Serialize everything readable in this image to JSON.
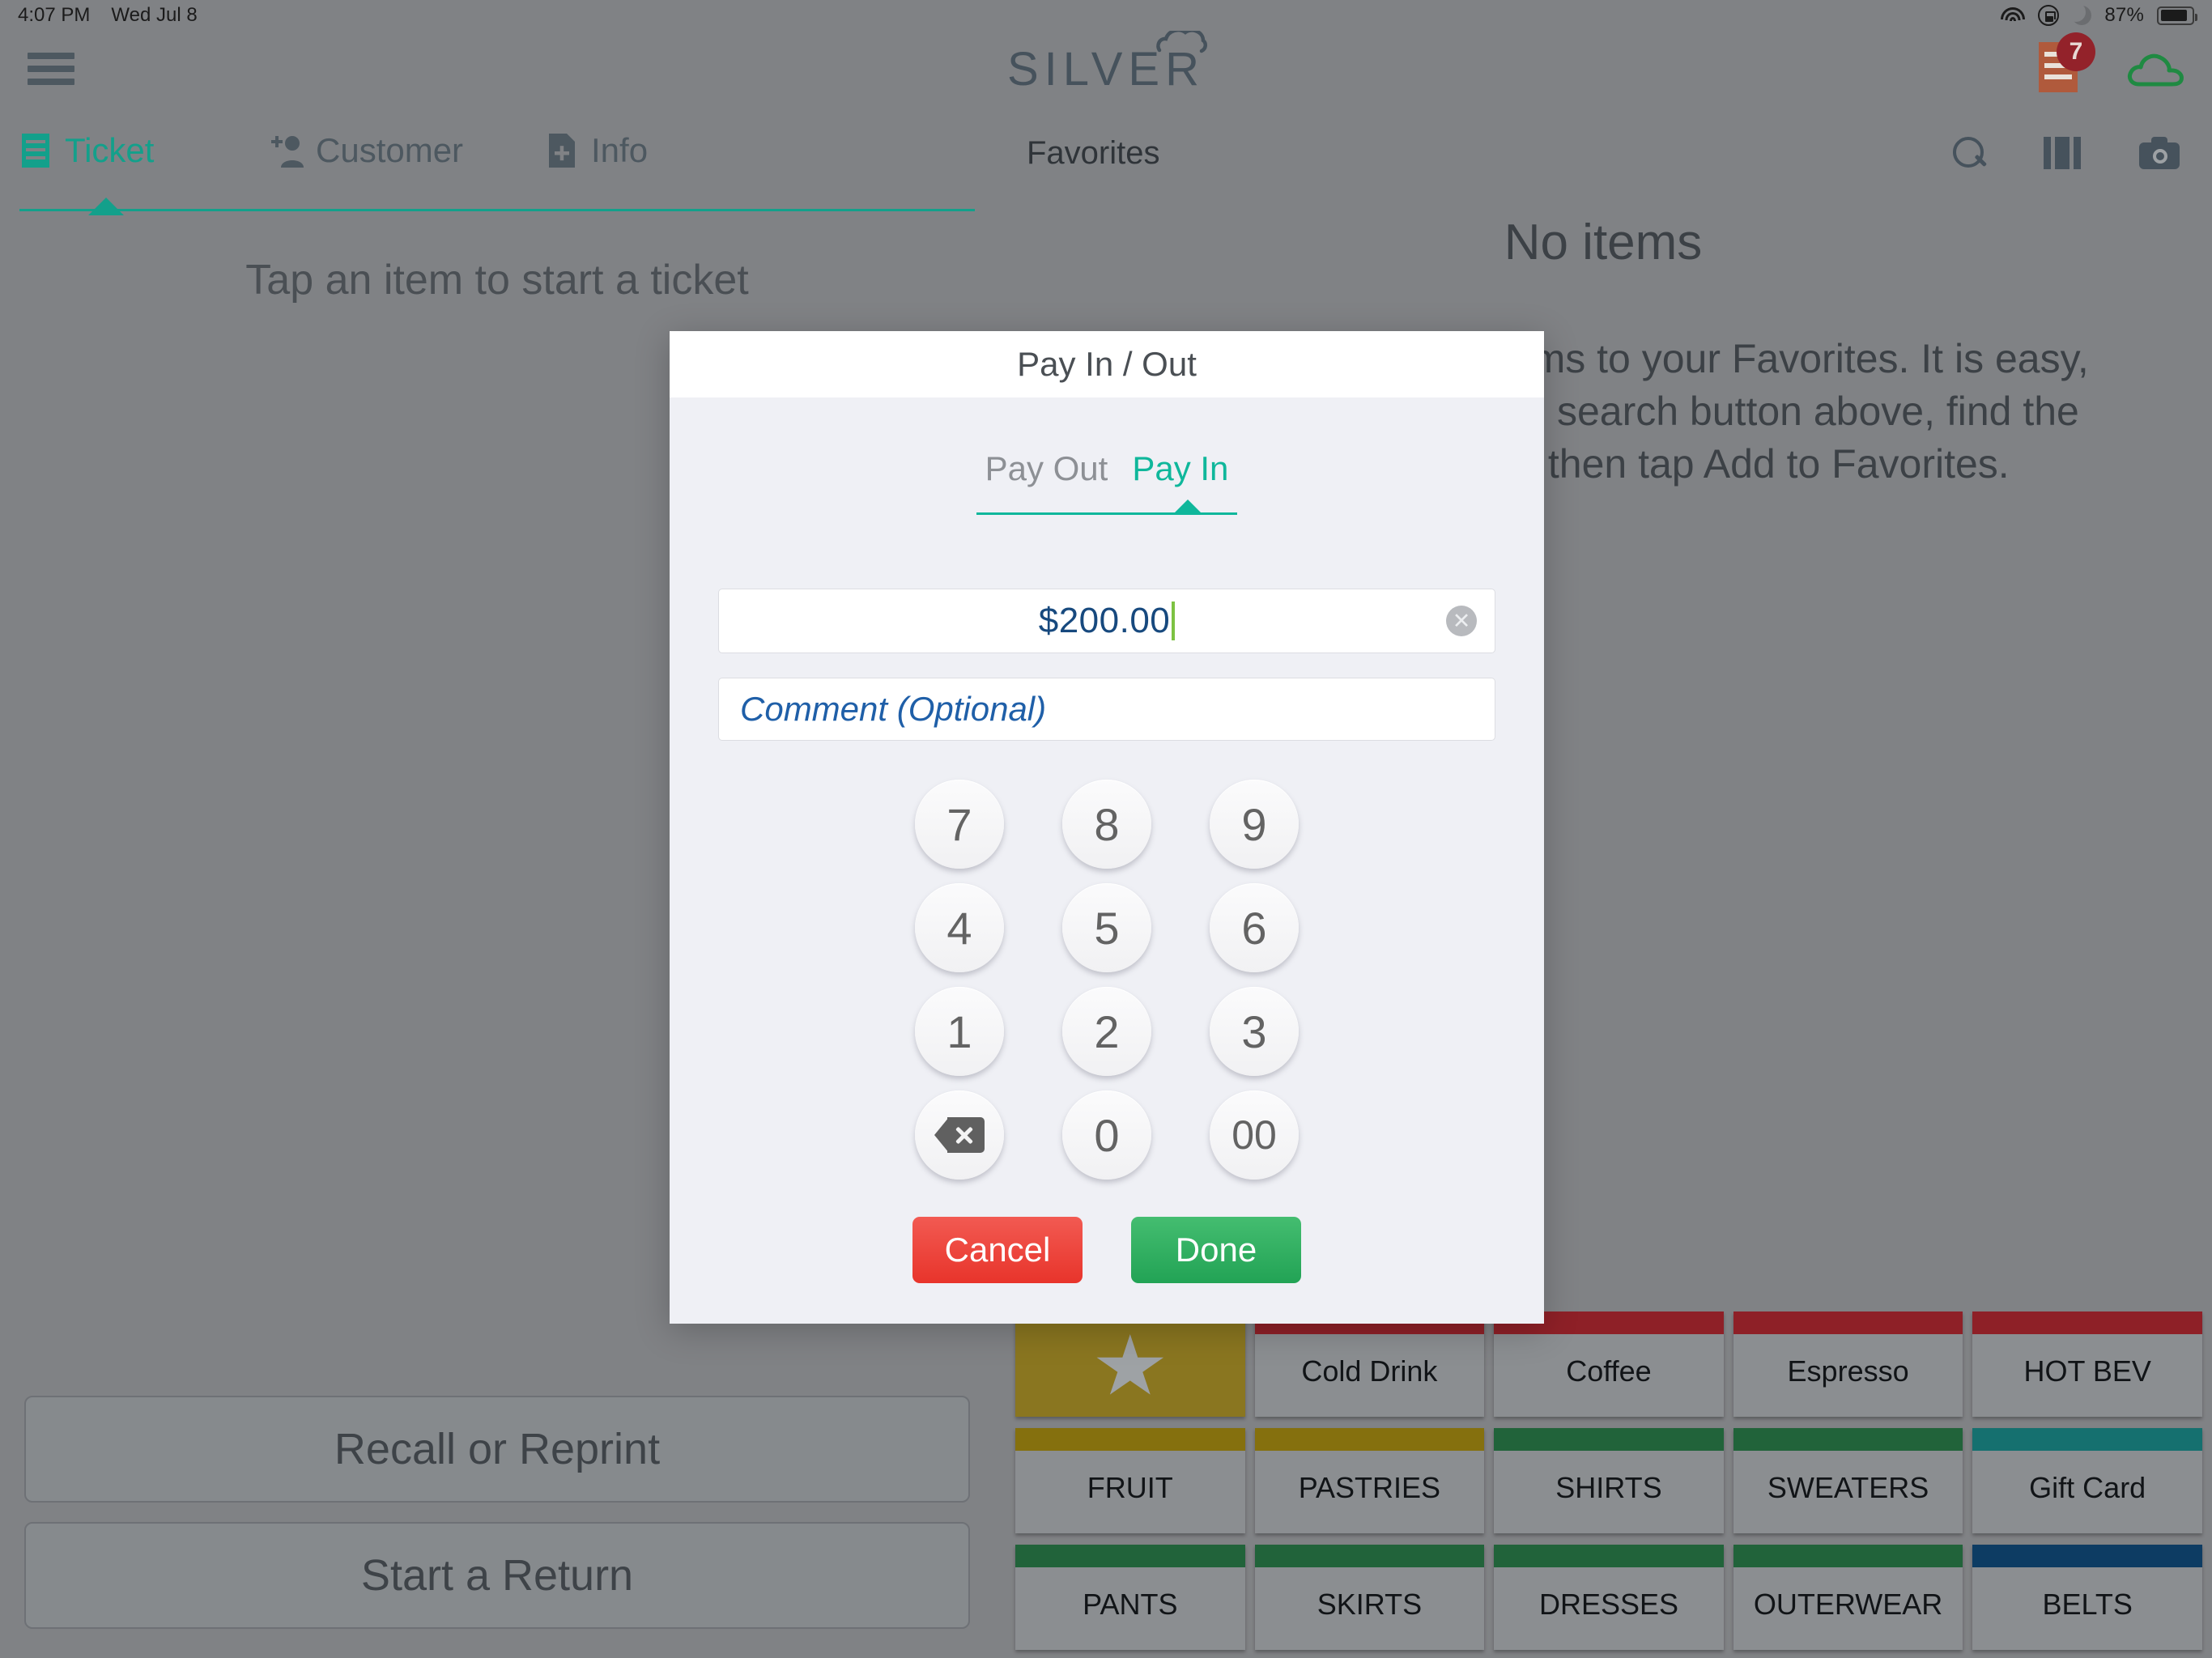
{
  "statusbar": {
    "time": "4:07 PM",
    "date": "Wed Jul 8",
    "battery_percent": "87%",
    "icons": [
      "wifi-icon",
      "rotation-lock-icon",
      "do-not-disturb-moon-icon",
      "battery-icon"
    ]
  },
  "appbar": {
    "menu_icon": "hamburger-menu-icon",
    "brand": "SILVER",
    "brand_cloud_icon": "cloud-icon",
    "open_tickets_icon": "receipt-icon",
    "open_tickets_badge": "7",
    "sync_icon": "cloud-sync-icon"
  },
  "left_pane": {
    "tabs": [
      {
        "label": "Ticket",
        "icon": "receipt-icon",
        "active": true
      },
      {
        "label": "Customer",
        "icon": "add-customer-icon",
        "active": false
      },
      {
        "label": "Info",
        "icon": "file-plus-icon",
        "active": false
      }
    ],
    "hint": "Tap an item to start a ticket",
    "buttons": [
      {
        "label": "Recall or Reprint"
      },
      {
        "label": "Start a Return"
      }
    ]
  },
  "right_pane": {
    "title": "Favorites",
    "icons": [
      "search-icon",
      "columns-layout-icon",
      "camera-icon"
    ],
    "empty_title": "No items",
    "empty_body": "Add your most used items to your Favorites. It is easy, just start by tapping the search button above, find the item you want, and then tap Add to Favorites.",
    "page_dots": {
      "count": 4,
      "active_index": 0
    },
    "categories": [
      {
        "label": "",
        "icon": "star-icon",
        "stripe": "#8a7620",
        "featured": true
      },
      {
        "label": "Cold Drink",
        "stripe": "#8e2027"
      },
      {
        "label": "Coffee",
        "stripe": "#8e2027"
      },
      {
        "label": "Espresso",
        "stripe": "#8e2027"
      },
      {
        "label": "HOT BEV",
        "stripe": "#8e2027"
      },
      {
        "label": "FRUIT",
        "stripe": "#85700e"
      },
      {
        "label": "PASTRIES",
        "stripe": "#85700e"
      },
      {
        "label": "SHIRTS",
        "stripe": "#21633a"
      },
      {
        "label": "SWEATERS",
        "stripe": "#21633a"
      },
      {
        "label": "Gift Card",
        "stripe": "#15706f"
      },
      {
        "label": "PANTS",
        "stripe": "#21633a"
      },
      {
        "label": "SKIRTS",
        "stripe": "#21633a"
      },
      {
        "label": "DRESSES",
        "stripe": "#21633a"
      },
      {
        "label": "OUTERWEAR",
        "stripe": "#21633a"
      },
      {
        "label": "BELTS",
        "stripe": "#0d3c63"
      }
    ]
  },
  "modal": {
    "title": "Pay In / Out",
    "segments": [
      {
        "label": "Pay Out",
        "active": false
      },
      {
        "label": "Pay In",
        "active": true
      }
    ],
    "amount_value": "$200.00",
    "amount_clear_icon": "clear-circle-icon",
    "comment_placeholder": "Comment (Optional)",
    "keypad": [
      "7",
      "8",
      "9",
      "4",
      "5",
      "6",
      "1",
      "2",
      "3",
      "backspace-icon",
      "0",
      "00"
    ],
    "cancel_label": "Cancel",
    "done_label": "Done"
  },
  "colors": {
    "accent_teal": "#0fb79b",
    "tab_active": "#13a08b",
    "danger_red": "#e8342b",
    "success_green": "#22a355",
    "amount_blue": "#17497e",
    "caret_green": "#7dc242",
    "chrome_gray": "#808285"
  }
}
